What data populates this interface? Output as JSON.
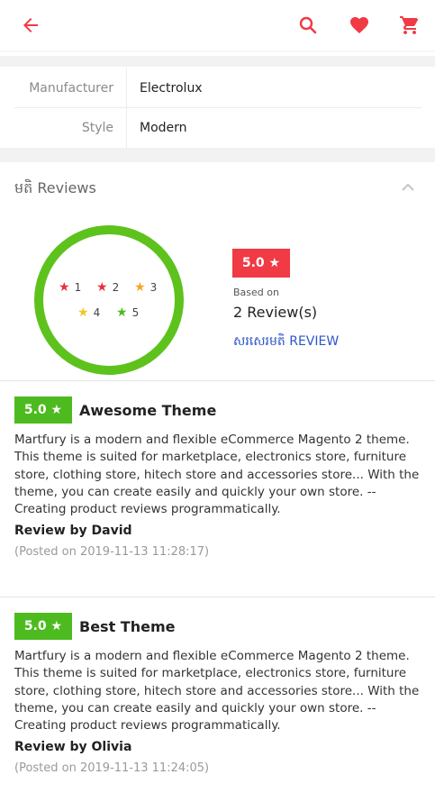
{
  "header": {
    "back_icon": "arrow-left-icon",
    "search_icon": "search-icon",
    "wishlist_icon": "heart-icon",
    "cart_icon": "cart-icon",
    "accent": "#f03a44"
  },
  "specs": [
    {
      "label": "Manufacturer",
      "value": "Electrolux"
    },
    {
      "label": "Style",
      "value": "Modern"
    }
  ],
  "reviews_section": {
    "title": "មតិ Reviews",
    "stars": [
      {
        "label": "1",
        "color": "#e8303c"
      },
      {
        "label": "2",
        "color": "#e8303c"
      },
      {
        "label": "3",
        "color": "#f5a623"
      },
      {
        "label": "4",
        "color": "#f5c623"
      },
      {
        "label": "5",
        "color": "#4dbb1f"
      }
    ],
    "average": "5.0 ★",
    "based_on": "Based on",
    "count": "2 Review(s)",
    "write_review": "សរសេរមតិ REVIEW"
  },
  "reviews": [
    {
      "rating": "5.0 ★",
      "title": "Awesome Theme",
      "body": "Martfury is a modern and flexible eCommerce Magento 2 theme. This theme is suited for marketplace, electronics store, furniture store, clothing store, hitech store and accessories store... With the theme, you can create easily and quickly your own store. -- Creating product reviews programmatically.",
      "author": "Review by David",
      "posted": "(Posted on 2019-11-13 11:28:17)"
    },
    {
      "rating": "5.0 ★",
      "title": "Best Theme",
      "body": "Martfury is a modern and flexible eCommerce Magento 2 theme. This theme is suited for marketplace, electronics store, furniture store, clothing store, hitech store and accessories store... With the theme, you can create easily and quickly your own store. -- Creating product reviews programmatically.",
      "author": "Review by Olivia",
      "posted": "(Posted on 2019-11-13 11:24:05)"
    }
  ]
}
